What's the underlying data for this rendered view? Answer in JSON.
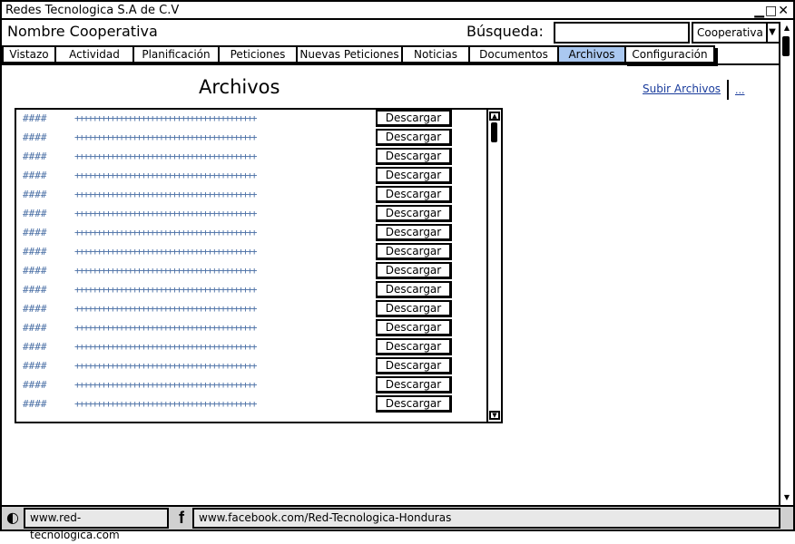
{
  "window": {
    "title": "Redes Tecnologica S.A de C.V"
  },
  "header": {
    "app_title": "Nombre Cooperativa",
    "search_label": "Búsqueda:",
    "search_value": "",
    "select_value": "Cooperativa"
  },
  "tabs": [
    {
      "label": "Vistazo"
    },
    {
      "label": "Actividad"
    },
    {
      "label": "Planificación"
    },
    {
      "label": "Peticiones"
    },
    {
      "label": "Nuevas Peticiones"
    },
    {
      "label": "Noticias"
    },
    {
      "label": "Documentos"
    },
    {
      "label": "Archivos",
      "active": true
    },
    {
      "label": "Configuración"
    }
  ],
  "main": {
    "title": "Archivos",
    "upload_link": "Subir Archivos",
    "more_link": "..."
  },
  "files": {
    "download_label": "Descargar",
    "rows": [
      {
        "id": "####",
        "name": "+++++++++++++++++++++++++++++++++++++++++"
      },
      {
        "id": "####",
        "name": "+++++++++++++++++++++++++++++++++++++++++"
      },
      {
        "id": "####",
        "name": "+++++++++++++++++++++++++++++++++++++++++"
      },
      {
        "id": "####",
        "name": "+++++++++++++++++++++++++++++++++++++++++"
      },
      {
        "id": "####",
        "name": "+++++++++++++++++++++++++++++++++++++++++"
      },
      {
        "id": "####",
        "name": "+++++++++++++++++++++++++++++++++++++++++"
      },
      {
        "id": "####",
        "name": "+++++++++++++++++++++++++++++++++++++++++"
      },
      {
        "id": "####",
        "name": "+++++++++++++++++++++++++++++++++++++++++"
      },
      {
        "id": "####",
        "name": "+++++++++++++++++++++++++++++++++++++++++"
      },
      {
        "id": "####",
        "name": "+++++++++++++++++++++++++++++++++++++++++"
      },
      {
        "id": "####",
        "name": "+++++++++++++++++++++++++++++++++++++++++"
      },
      {
        "id": "####",
        "name": "+++++++++++++++++++++++++++++++++++++++++"
      },
      {
        "id": "####",
        "name": "+++++++++++++++++++++++++++++++++++++++++"
      },
      {
        "id": "####",
        "name": "+++++++++++++++++++++++++++++++++++++++++"
      },
      {
        "id": "####",
        "name": "+++++++++++++++++++++++++++++++++++++++++"
      },
      {
        "id": "####",
        "name": "+++++++++++++++++++++++++++++++++++++++++"
      }
    ]
  },
  "footer": {
    "site_url": "www.red-tecnologica.com",
    "facebook_url": "www.facebook.com/Red-Tecnologica-Honduras"
  },
  "icons": {
    "window_controls": "minimize-maximize-close",
    "footer_left": "swirl-logo-icon",
    "footer_mid": "facebook-icon"
  },
  "colors": {
    "active_tab": "#aac8f0",
    "link": "#1a3c9c",
    "list_text": "#4a6fa5",
    "footer_bg": "#d0d0d0"
  }
}
